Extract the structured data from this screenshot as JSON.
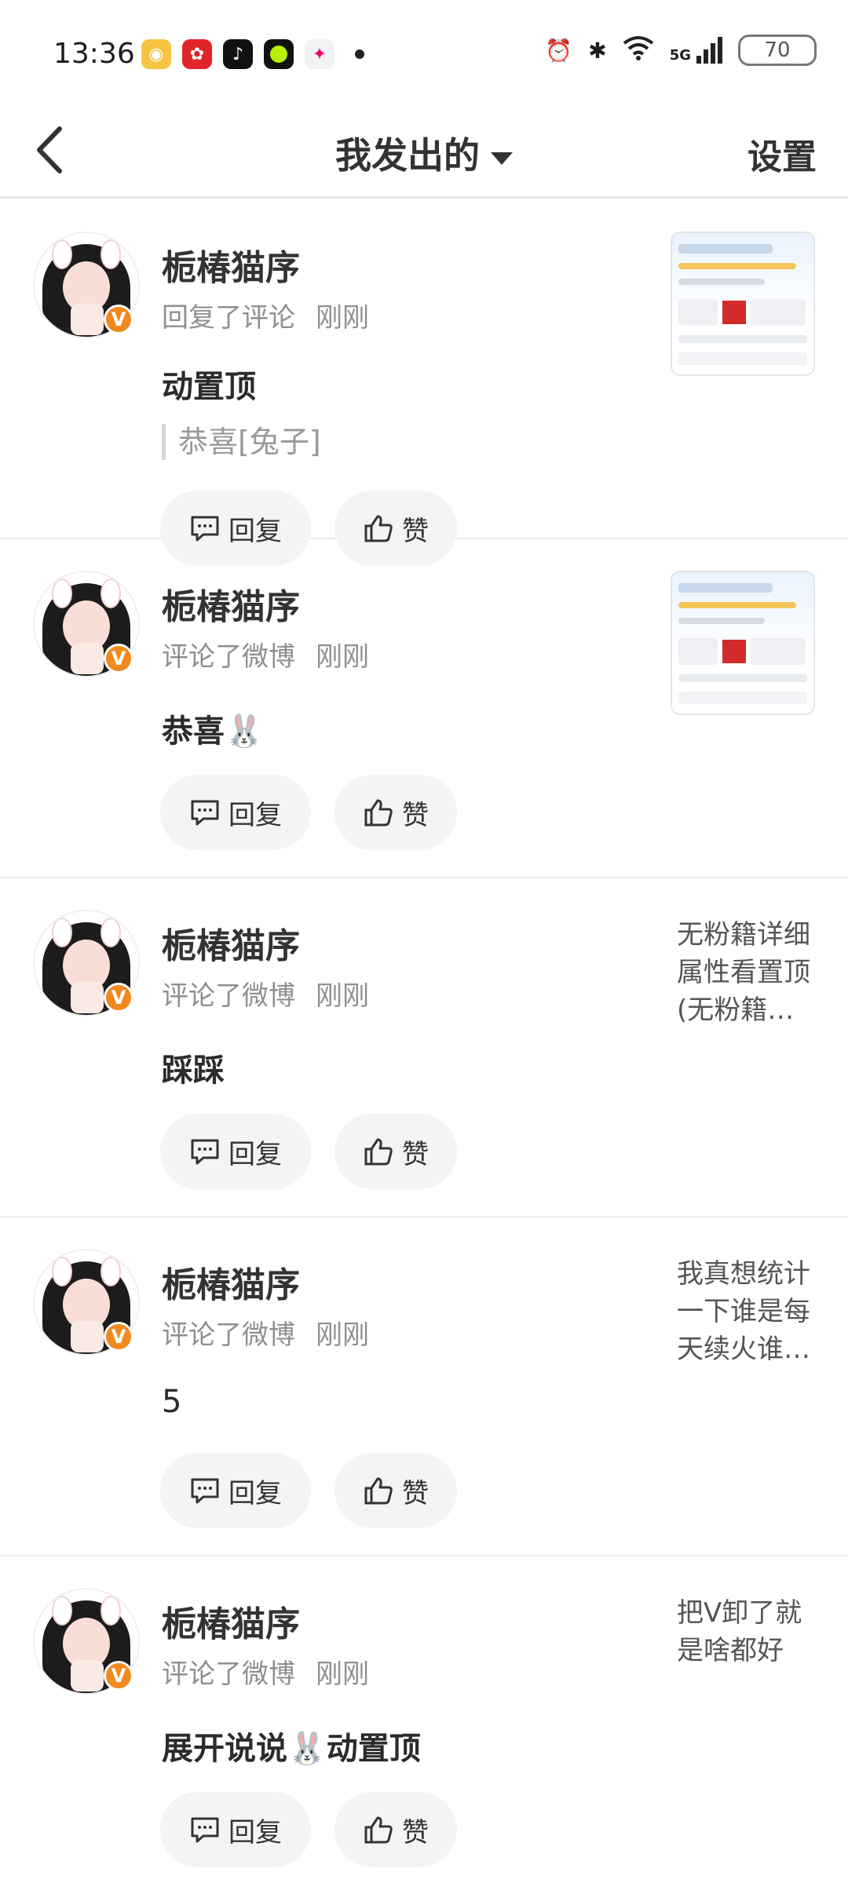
{
  "status_bar": {
    "time": "13:36",
    "app_icons": [
      "weibo-icon",
      "app-red-icon",
      "tiktok-icon",
      "app-green-icon",
      "app-colorful-icon"
    ],
    "network": "5G",
    "battery": "70"
  },
  "nav": {
    "title": "我发出的",
    "settings_label": "设置"
  },
  "actions": {
    "reply_label": "回复",
    "like_label": "赞"
  },
  "items": [
    {
      "name": "栀椿猫序",
      "action": "回复了评论",
      "time": "刚刚",
      "content": "动置顶",
      "quote": "恭喜[兔子]",
      "right_type": "thumbnail",
      "snippet": ""
    },
    {
      "name": "栀椿猫序",
      "action": "评论了微博",
      "time": "刚刚",
      "content": "恭喜🐰",
      "quote": "",
      "right_type": "thumbnail",
      "snippet": ""
    },
    {
      "name": "栀椿猫序",
      "action": "评论了微博",
      "time": "刚刚",
      "content": "踩踩",
      "quote": "",
      "right_type": "text",
      "snippet": "无粉籍详细属性看置顶(无粉籍…"
    },
    {
      "name": "栀椿猫序",
      "action": "评论了微博",
      "time": "刚刚",
      "content": "5",
      "quote": "",
      "right_type": "text",
      "snippet": "我真想统计一下谁是每天续火谁…"
    },
    {
      "name": "栀椿猫序",
      "action": "评论了微博",
      "time": "刚刚",
      "content": "展开说说🐰动置顶",
      "quote": "",
      "right_type": "text",
      "snippet": "把V卸了就是啥都好"
    }
  ]
}
